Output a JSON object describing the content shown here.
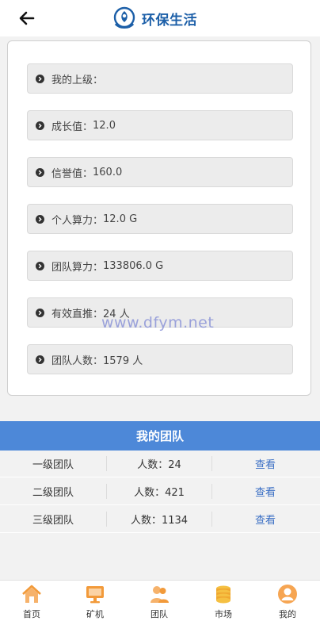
{
  "header": {
    "title": "环保生活",
    "back_icon": "arrow-left-icon",
    "logo_icon": "eco-logo-icon"
  },
  "info": {
    "items": [
      {
        "label": "我的上级：",
        "value": ""
      },
      {
        "label": "成长值：",
        "value": "12.0"
      },
      {
        "label": "信誉值：",
        "value": "160.0"
      },
      {
        "label": "个人算力：",
        "value": "12.0 G"
      },
      {
        "label": "团队算力：",
        "value": "133806.0 G"
      },
      {
        "label": "有效直推：",
        "value": "24 人"
      },
      {
        "label": "团队人数：",
        "value": "1579 人"
      }
    ]
  },
  "watermark": "www.dfym.net",
  "team": {
    "title": "我的团队",
    "rows": [
      {
        "level": "一级团队",
        "count": "人数：24",
        "action": "查看"
      },
      {
        "level": "二级团队",
        "count": "人数：421",
        "action": "查看"
      },
      {
        "level": "三级团队",
        "count": "人数：1134",
        "action": "查看"
      }
    ]
  },
  "nav": {
    "items": [
      {
        "label": "首页",
        "icon": "home-icon"
      },
      {
        "label": "矿机",
        "icon": "monitor-icon"
      },
      {
        "label": "团队",
        "icon": "team-icon"
      },
      {
        "label": "市场",
        "icon": "coins-icon"
      },
      {
        "label": "我的",
        "icon": "user-icon"
      }
    ]
  },
  "colors": {
    "brand": "#1c5fa8",
    "team_header": "#4d88d8",
    "link": "#3b6fc4",
    "nav_icon": "#f29a3a"
  }
}
